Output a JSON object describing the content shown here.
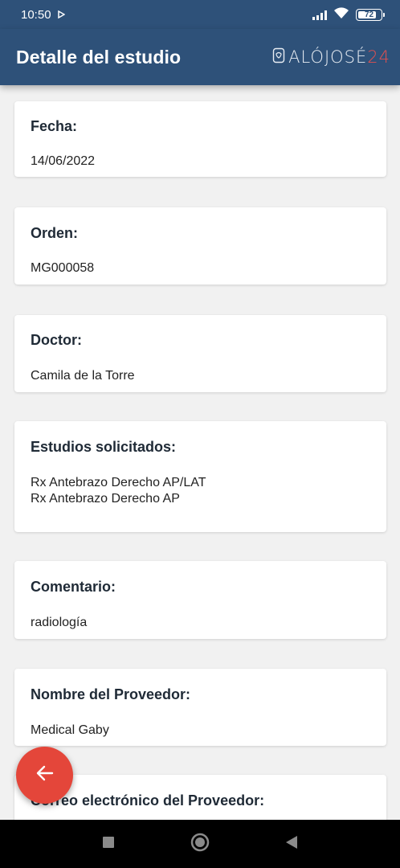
{
  "status_bar": {
    "time": "10:50",
    "battery": "72"
  },
  "app_bar": {
    "title": "Detalle del estudio",
    "logo_text": "ALÓJOSÉ",
    "logo_number": "24"
  },
  "cards": [
    {
      "label": "Fecha:",
      "values": [
        "14/06/2022"
      ]
    },
    {
      "label": "Orden:",
      "values": [
        "MG000058"
      ]
    },
    {
      "label": "Doctor:",
      "values": [
        "Camila de la Torre"
      ]
    },
    {
      "label": "Estudios solicitados:",
      "values": [
        "Rx Antebrazo Derecho AP/LAT",
        "Rx Antebrazo Derecho AP"
      ]
    },
    {
      "label": "Comentario:",
      "values": [
        "radiología"
      ]
    },
    {
      "label": "Nombre del Proveedor:",
      "values": [
        "Medical Gaby"
      ]
    },
    {
      "label": "Correo electrónico del Proveedor:",
      "values": []
    }
  ],
  "colors": {
    "primary": "#2e5179",
    "fab": "#e4463a",
    "background": "#f1f1f1"
  },
  "icons": {
    "fab": "arrow-left-icon"
  }
}
